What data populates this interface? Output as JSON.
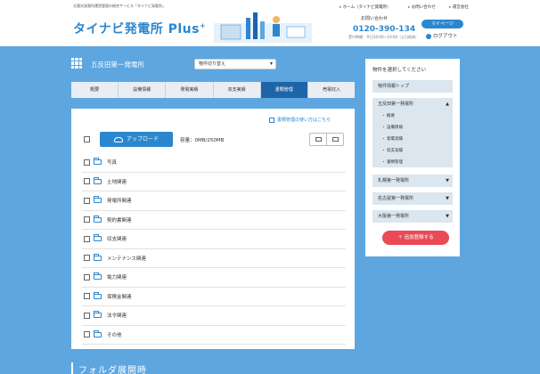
{
  "header": {
    "tagline": "太陽光発電所運営管理の総合サービス「タイナビ発電所」",
    "logo_text": "タイナビ発電所 Plus",
    "logo_sup": "+",
    "nav": [
      "ホーム（タイナビ発電所）",
      "お問い合わせ",
      "運営会社"
    ],
    "contact_label": "お問い合わせ",
    "tel": "0120-390-134",
    "tel_hours": "受付時間：平日10:00〜19:00（土日祝休）",
    "mypage": "マイページ",
    "logout": "ログアウト"
  },
  "plant": {
    "title": "五反田第一発電所",
    "switch_placeholder": "物件切り替え"
  },
  "tabs": [
    "概要",
    "設備情報",
    "発電実績",
    "収支実績",
    "書類管理",
    "売電収入"
  ],
  "active_tab_index": 4,
  "docs": {
    "help_link": "書類管理の使い方はこちら",
    "upload_label": "アップロード",
    "capacity": "容量：0MB/250MB",
    "folders": [
      "写真",
      "土地関連",
      "発電所関連",
      "契約書関連",
      "収支関連",
      "メンテナンス関連",
      "電力関連",
      "保険金関連",
      "法令関連",
      "その他"
    ]
  },
  "section_heading": "フォルダ展開時",
  "sidebar": {
    "title": "物件を選択してください",
    "top_link": "物件情報トップ",
    "current_plant": "五反田第一発電所",
    "subitems": [
      "概要",
      "設備情報",
      "発電実績",
      "収支実績",
      "書類管理"
    ],
    "other_plants": [
      "札幌第一発電所",
      "名古屋第一発電所",
      "大阪第一発電所"
    ],
    "add_button": "追加登録する"
  },
  "colors": {
    "background": "#5ea6e0",
    "primary": "#2a87cf",
    "active_tab": "#1e64a8",
    "add_button": "#e94a55"
  }
}
